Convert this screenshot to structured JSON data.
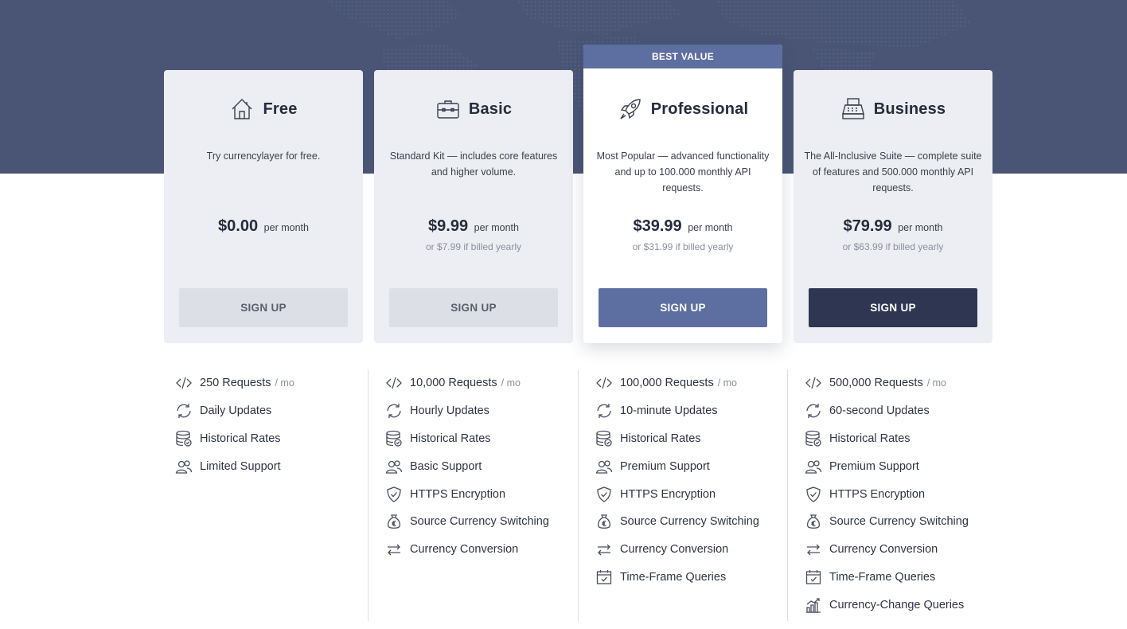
{
  "colors": {
    "hero": "#4a5575",
    "accent": "#5d6ea0",
    "dark": "#2f3652",
    "card": "#eceef3"
  },
  "plans": [
    {
      "name": "Free",
      "icon": "house-icon",
      "description": "Try currencylayer for free.",
      "price": "$0.00",
      "per": "per month",
      "yearly": "",
      "button": "SIGN UP",
      "ribbon": ""
    },
    {
      "name": "Basic",
      "icon": "briefcase-icon",
      "description": "Standard Kit — includes core features and higher volume.",
      "price": "$9.99",
      "per": "per month",
      "yearly": "or $7.99 if billed yearly",
      "button": "SIGN UP",
      "ribbon": ""
    },
    {
      "name": "Professional",
      "icon": "rocket-icon",
      "description": "Most Popular — advanced functionality and up to 100.000 monthly API requests.",
      "price": "$39.99",
      "per": "per month",
      "yearly": "or $31.99 if billed yearly",
      "button": "SIGN UP",
      "ribbon": "BEST VALUE"
    },
    {
      "name": "Business",
      "icon": "cash-register-icon",
      "description": "The All-Inclusive Suite — complete suite of features and 500.000 monthly API requests.",
      "price": "$79.99",
      "per": "per month",
      "yearly": "or $63.99 if billed yearly",
      "button": "SIGN UP",
      "ribbon": ""
    }
  ],
  "features": [
    {
      "requests": "250 Requests",
      "unit": "/ mo",
      "items": [
        "Daily Updates",
        "Historical Rates",
        "Limited Support"
      ]
    },
    {
      "requests": "10,000 Requests",
      "unit": "/ mo",
      "items": [
        "Hourly Updates",
        "Historical Rates",
        "Basic Support",
        "HTTPS Encryption",
        "Source Currency Switching",
        "Currency Conversion"
      ]
    },
    {
      "requests": "100,000 Requests",
      "unit": "/ mo",
      "items": [
        "10-minute Updates",
        "Historical Rates",
        "Premium Support",
        "HTTPS Encryption",
        "Source Currency Switching",
        "Currency Conversion",
        "Time-Frame Queries"
      ]
    },
    {
      "requests": "500,000 Requests",
      "unit": "/ mo",
      "items": [
        "60-second Updates",
        "Historical Rates",
        "Premium Support",
        "HTTPS Encryption",
        "Source Currency Switching",
        "Currency Conversion",
        "Time-Frame Queries",
        "Currency-Change Queries"
      ]
    }
  ],
  "feature_icons": [
    "code-icon",
    "refresh-icon",
    "database-icon",
    "users-icon",
    "shield-icon",
    "money-bag-icon",
    "exchange-arrows-icon",
    "calendar-icon",
    "bar-chart-icon"
  ]
}
